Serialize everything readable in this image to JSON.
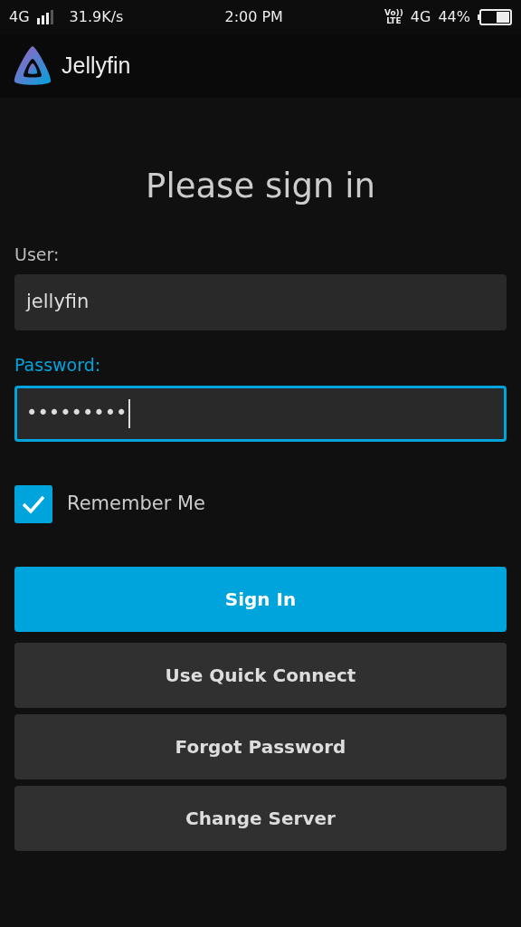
{
  "status_bar": {
    "network": "4G",
    "speed": "31.9K/s",
    "time": "2:00 PM",
    "volte": "Vo))",
    "volte_sub": "LTE",
    "data_network": "4G",
    "battery": "44%"
  },
  "header": {
    "app_name": "Jellyfin"
  },
  "title": "Please sign in",
  "fields": [
    {
      "label": "User:",
      "value": "jellyfin",
      "focused": false
    },
    {
      "label": "Password:",
      "value": "•••••••••",
      "focused": true
    }
  ],
  "remember": {
    "label": "Remember Me",
    "checked": true
  },
  "buttons": [
    {
      "label": "Sign In",
      "kind": "primary"
    },
    {
      "label": "Use Quick Connect",
      "kind": "secondary"
    },
    {
      "label": "Forgot Password",
      "kind": "secondary"
    },
    {
      "label": "Change Server",
      "kind": "secondary"
    }
  ]
}
